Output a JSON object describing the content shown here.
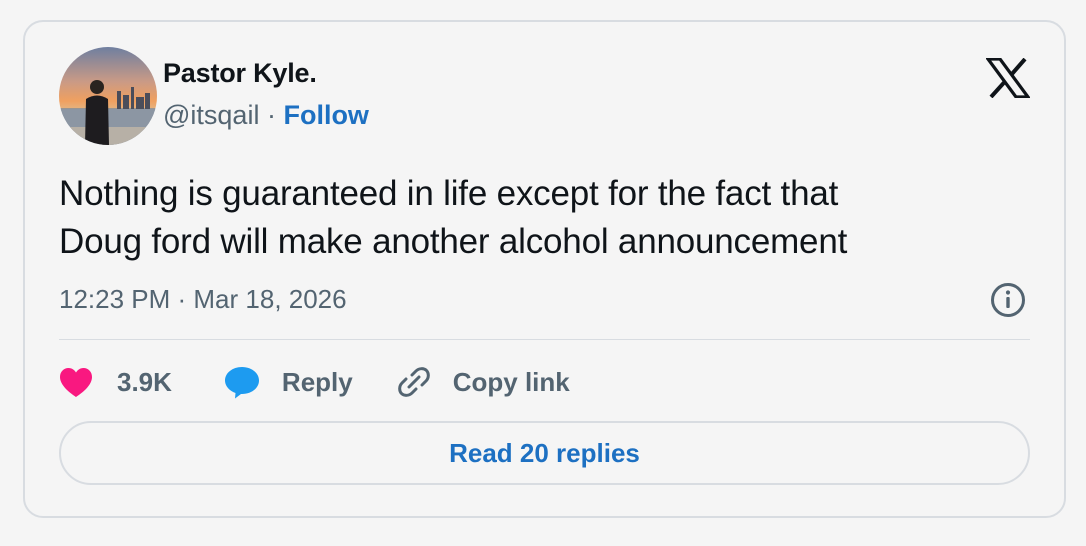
{
  "author": {
    "display_name": "Pastor Kyle.",
    "handle": "@itsqail",
    "separator": " · ",
    "follow_label": "Follow"
  },
  "tweet": {
    "line1": "Nothing is guaranteed in life except for the fact that",
    "line2": "Doug ford will make another alcohol announcement",
    "timestamp": "12:23 PM · Mar 18, 2026"
  },
  "actions": {
    "like_count": "3.9K",
    "reply_label": "Reply",
    "copy_link_label": "Copy link",
    "read_replies_label": "Read 20 replies"
  },
  "icons": {
    "platform_logo": "x-logo-icon",
    "info": "info-icon",
    "like": "heart-icon",
    "reply": "speech-bubble-icon",
    "copy_link": "link-icon"
  },
  "colors": {
    "text_primary": "#0f1419",
    "text_secondary": "#536471",
    "link_blue": "#1d70c2",
    "heart_pink": "#f91880",
    "reply_blue": "#1d9bf0",
    "border": "#d8dce1",
    "background": "#f5f5f5"
  }
}
